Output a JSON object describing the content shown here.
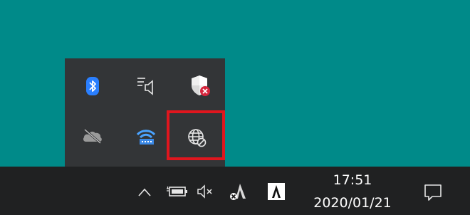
{
  "desktop": {
    "background_color": "#008a89"
  },
  "overflow_panel": {
    "background_color": "#333537",
    "icons": [
      {
        "name": "bluetooth-icon"
      },
      {
        "name": "notification-speaker-icon"
      },
      {
        "name": "security-shield-error-icon"
      },
      {
        "name": "onedrive-offline-icon"
      },
      {
        "name": "network-adapter-icon"
      },
      {
        "name": "globe-network-icon",
        "highlighted": true
      }
    ],
    "highlight_color": "#e0161e"
  },
  "taskbar": {
    "background_color": "#202122",
    "tray": [
      "show-hidden-icons-chevron",
      "battery-icon",
      "volume-muted-icon",
      "app-a-icon",
      "app-a-box-icon"
    ],
    "clock": {
      "time": "17:51",
      "date": "2020/01/21"
    },
    "notification_button": "action-center-icon"
  }
}
